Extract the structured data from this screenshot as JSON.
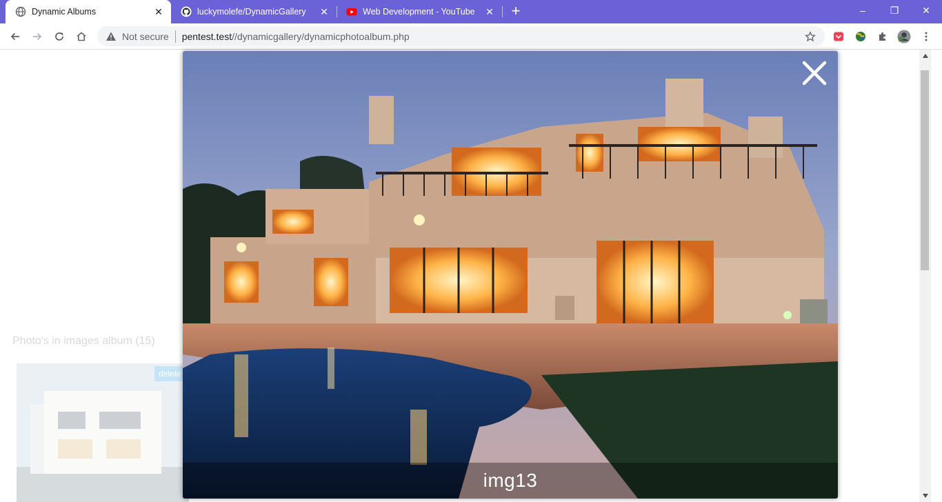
{
  "browser": {
    "tabs": [
      {
        "title": "Dynamic Albums",
        "icon": "globe-icon",
        "active": true
      },
      {
        "title": "luckymolefe/DynamicGallery",
        "icon": "github-icon",
        "active": false
      },
      {
        "title": "Web Development - YouTube",
        "icon": "youtube-icon",
        "active": false
      }
    ],
    "new_tab_label": "+",
    "window_controls": {
      "minimize": "–",
      "restore": "❐",
      "close": "✕"
    },
    "omnibox": {
      "security_label": "Not secure",
      "url_host": "pentest.test",
      "url_path": "//dynamicgallery/dynamicphotoalbum.php"
    },
    "accent_color": "#6b62d8"
  },
  "page": {
    "album_heading": "Photo's in images album (15)",
    "thumbnail_delete_label": "delete"
  },
  "lightbox": {
    "caption": "img13",
    "close_icon": "close-icon"
  }
}
